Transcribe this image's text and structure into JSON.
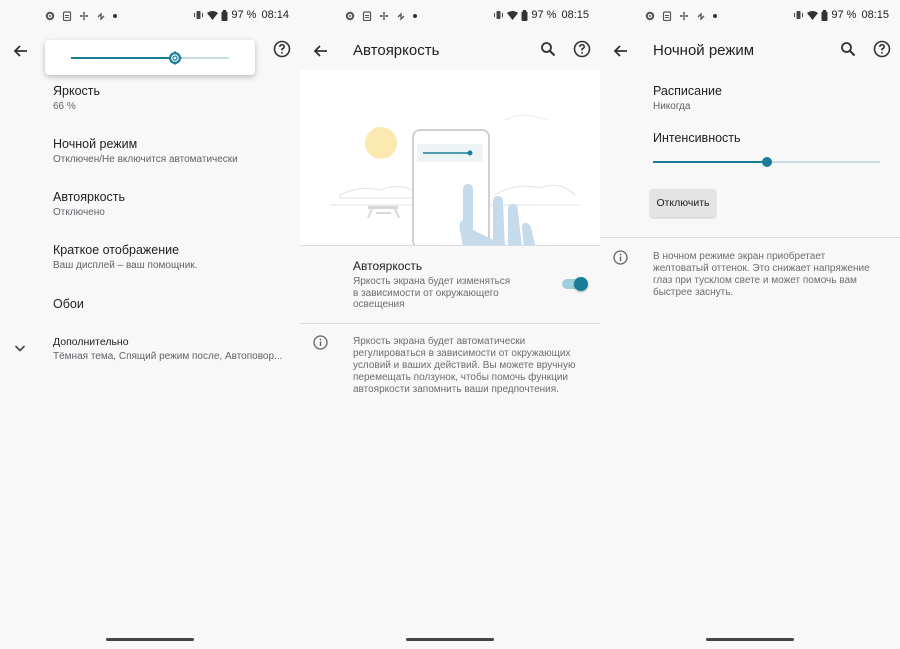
{
  "status_bars": [
    {
      "battery": "97 %",
      "time": "08:14"
    },
    {
      "battery": "97 %",
      "time": "08:15"
    },
    {
      "battery": "97 %",
      "time": "08:15"
    }
  ],
  "display_settings": {
    "brightness_slider_level": 0.66,
    "items": [
      {
        "title": "Яркость",
        "summary": "66 %"
      },
      {
        "title": "Ночной режим",
        "summary": "Отключен/Не включится автоматически"
      },
      {
        "title": "Автояркость",
        "summary": "Отключено"
      },
      {
        "title": "Краткое отображение",
        "summary": "Ваш дисплей – ваш помощник."
      },
      {
        "title": "Обои",
        "summary": ""
      },
      {
        "title": "Дополнительно",
        "summary": "Тёмная тема, Спящий режим после, Автоповор..."
      }
    ]
  },
  "adaptive_brightness": {
    "title": "Автояркость",
    "toggle_label": "Автояркость",
    "toggle_summary_lines": [
      "Яркость экрана будет изменяться",
      "в зависимости от окружающего",
      "освещения"
    ],
    "toggle_on": true,
    "info_lines": [
      "Яркость экрана будет автоматически",
      "регулироваться в зависимости от окружающих",
      "условий и ваших действий. Вы можете вручную",
      "перемещать ползунок, чтобы помочь функции",
      "автояркости запомнить ваши предпочтения."
    ],
    "accent_color": "#1a7e99"
  },
  "night_light": {
    "title": "Ночной режим",
    "schedule_title": "Расписание",
    "schedule_value": "Никогда",
    "intensity_title": "Интенсивность",
    "intensity_level": 0.5,
    "button_label": "Отключить",
    "info_lines": [
      "В ночном режиме экран приобретает",
      "желтоватый оттенок. Это снижает напряжение",
      "глаз при тусклом свете и может помочь вам",
      "быстрее заснуть."
    ]
  }
}
